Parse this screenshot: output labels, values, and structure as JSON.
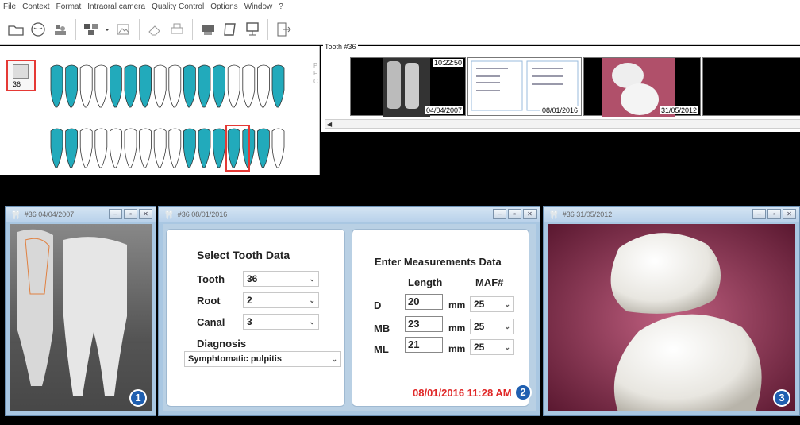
{
  "menu": [
    "File",
    "Context",
    "Format",
    "Intraoral camera",
    "Quality Control",
    "Options",
    "Window",
    "?"
  ],
  "toolbar": {
    "icons": [
      "open-folder-icon",
      "chart-icon",
      "patients-icon",
      "layout-icon",
      "dropdown-icon",
      "image-import-icon",
      "eraser-icon",
      "print-icon",
      "scanner-icon",
      "frame-icon",
      "monitor-icon",
      "exit-icon"
    ]
  },
  "chart": {
    "selected_tooth": "36",
    "side_letters": [
      "P",
      "F",
      "C"
    ]
  },
  "timeline": {
    "title": "Tooth #36",
    "thumbs": [
      {
        "time": "10:22:50",
        "date": "04/04/2007"
      },
      {
        "date": "08/01/2016"
      },
      {
        "date": "31/05/2012"
      }
    ]
  },
  "win1": {
    "title": "#36 04/04/2007",
    "badge": "1"
  },
  "win2": {
    "title": "#36 08/01/2016",
    "badge": "2",
    "select_header": "Select Tooth Data",
    "tooth_label": "Tooth",
    "tooth_value": "36",
    "root_label": "Root",
    "root_value": "2",
    "canal_label": "Canal",
    "canal_value": "3",
    "diagnosis_label": "Diagnosis",
    "diagnosis_value": "Symphtomatic pulpitis",
    "measure_header": "Enter Measurements Data",
    "length_header": "Length",
    "maf_header": "MAF#",
    "rows": [
      {
        "label": "D",
        "length": "20",
        "unit": "mm",
        "maf": "25"
      },
      {
        "label": "MB",
        "length": "23",
        "unit": "mm",
        "maf": "25"
      },
      {
        "label": "ML",
        "length": "21",
        "unit": "mm",
        "maf": "25"
      }
    ],
    "timestamp": "08/01/2016 11:28 AM"
  },
  "win3": {
    "title": "#36 31/05/2012",
    "badge": "3"
  },
  "colors": {
    "tooth_highlight": "#22aabb",
    "selection": "#e53935",
    "window_frame": "#a9c7e2",
    "timestamp": "#e02828"
  }
}
